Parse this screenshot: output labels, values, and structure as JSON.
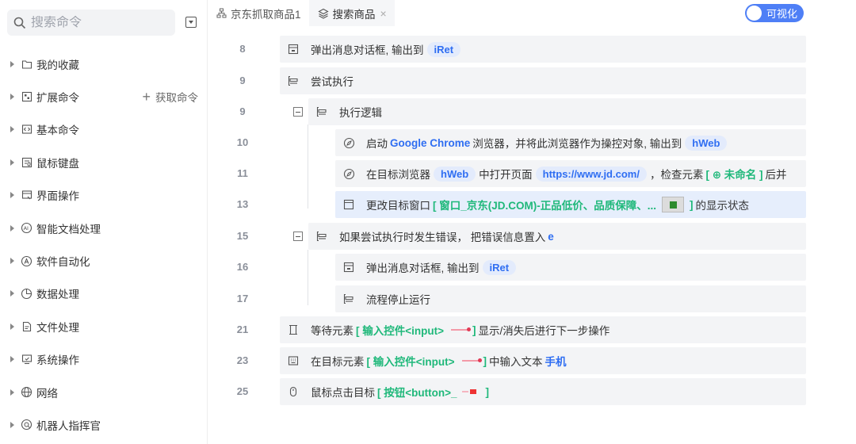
{
  "sidebar": {
    "search_placeholder": "搜索命令",
    "get_commands": "获取命令",
    "categories": [
      {
        "label": "我的收藏",
        "icon": "folder-icon"
      },
      {
        "label": "扩展命令",
        "icon": "extension-icon"
      },
      {
        "label": "基本命令",
        "icon": "code-icon"
      },
      {
        "label": "鼠标键盘",
        "icon": "keyboard-mouse-icon"
      },
      {
        "label": "界面操作",
        "icon": "window-icon"
      },
      {
        "label": "智能文档处理",
        "icon": "ai-document-icon"
      },
      {
        "label": "软件自动化",
        "icon": "automation-icon"
      },
      {
        "label": "数据处理",
        "icon": "pie-chart-icon"
      },
      {
        "label": "文件处理",
        "icon": "file-icon"
      },
      {
        "label": "系统操作",
        "icon": "system-icon"
      },
      {
        "label": "网络",
        "icon": "globe-icon"
      },
      {
        "label": "机器人指挥官",
        "icon": "robot-commander-icon"
      }
    ]
  },
  "tabs": [
    {
      "label": "京东抓取商品1",
      "icon": "flow-icon",
      "active": false
    },
    {
      "label": "搜索商品",
      "icon": "layers-icon",
      "active": true,
      "close": "×"
    }
  ],
  "toggle": {
    "label": "可视化",
    "on": true
  },
  "rows": [
    {
      "line": "8",
      "text_a": "弹出消息对话框, 输出到",
      "pill": "iRet"
    },
    {
      "line": "9",
      "text_a": "尝试执行"
    },
    {
      "line": "9",
      "text_a": "执行逻辑"
    },
    {
      "line": "10",
      "text_a": "启动",
      "kw": "Google Chrome",
      "text_b": "浏览器，并将此浏览器作为操控对象, 输出到",
      "pill": "hWeb"
    },
    {
      "line": "11",
      "text_a": "在目标浏览器",
      "pill": "hWeb",
      "text_b": "中打开页面",
      "pill2": "https://www.jd.com/",
      "text_c": "，检查元素",
      "green": "[ ⊕ 未命名 ]",
      "text_d": "后并"
    },
    {
      "line": "13",
      "text_a": "更改目标窗口",
      "green": "[ 窗口_京东(JD.COM)-正品低价、品质保障、...",
      "green2": "]",
      "text_b": "的显示状态"
    },
    {
      "line": "15",
      "text_a": "如果尝试执行时发生错误，  把错误信息置入",
      "kw": "e"
    },
    {
      "line": "16",
      "text_a": "弹出消息对话框, 输出到",
      "pill": "iRet"
    },
    {
      "line": "17",
      "text_a": "流程停止运行"
    },
    {
      "line": "21",
      "text_a": "等待元素",
      "green": "[ 输入控件<input>",
      "green2": "]",
      "text_b": "显示/消失后进行下一步操作"
    },
    {
      "line": "23",
      "text_a": "在目标元素",
      "green": "[ 输入控件<input>",
      "green2": "]",
      "text_b": "中输入文本",
      "kw": "手机"
    },
    {
      "line": "25",
      "text_a": "鼠标点击目标",
      "green": "[ 按钮<button>_",
      "green2": "]"
    }
  ]
}
